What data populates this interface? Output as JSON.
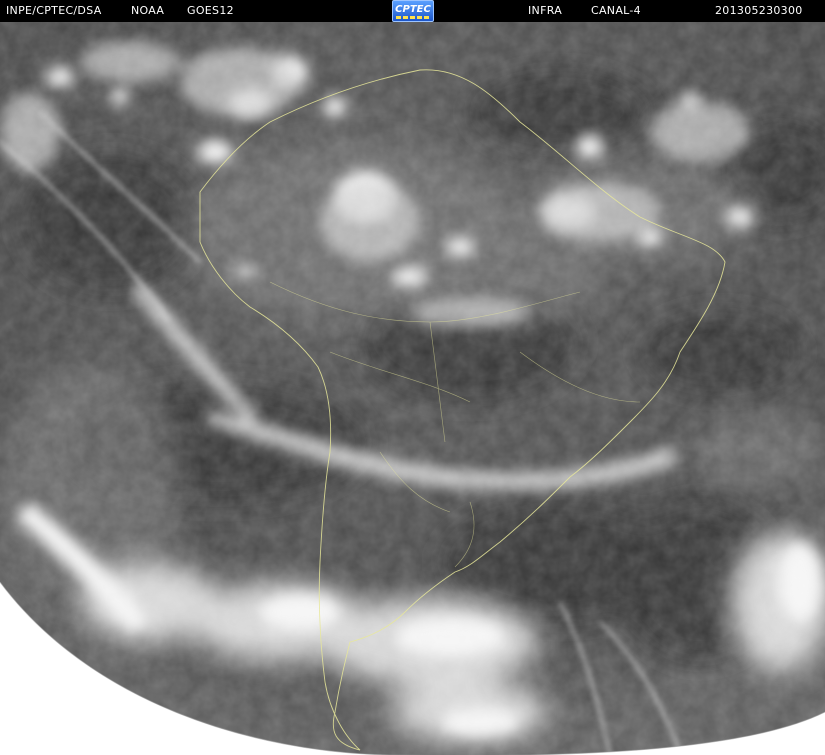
{
  "header": {
    "source": "INPE/CPTEC/DSA",
    "agency": "NOAA",
    "satellite": "GOES12",
    "logo_text": "CPTEC",
    "band": "INFRA",
    "channel": "CANAL-4",
    "timestamp": "201305230300"
  },
  "colors": {
    "header_bg": "#000000",
    "header_text": "#ffffff",
    "background": "#ffffff",
    "earth_base": "#4a4a4a",
    "coastline": "#e8e89a"
  }
}
